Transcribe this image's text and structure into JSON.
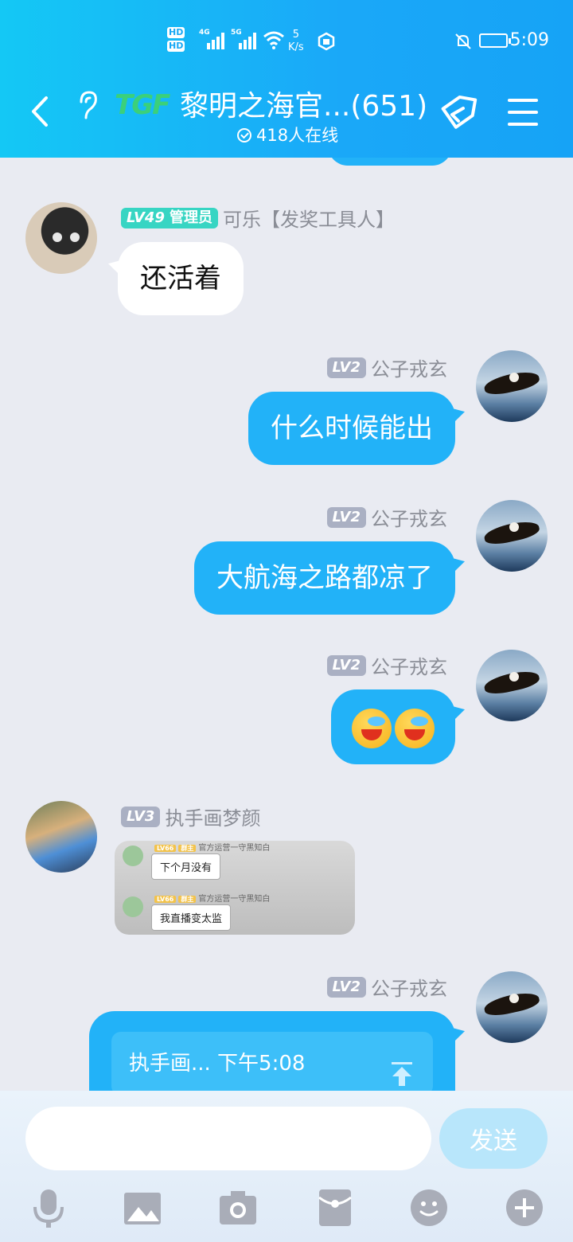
{
  "status_bar": {
    "hd1": "HD",
    "hd2": "HD",
    "net1": "4G",
    "net2": "5G",
    "speed_value": "5",
    "speed_unit": "K/s",
    "time": "5:09"
  },
  "header": {
    "group_logo": "TGF",
    "group_title": "黎明之海官...(651)",
    "online_count": "418人在线",
    "back_icon": "back-arrow-icon",
    "ear_icon": "ear-icon",
    "tag_icon": "tag-icon",
    "menu_icon": "menu-icon"
  },
  "messages": [
    {
      "side": "left",
      "level": "LV49",
      "role": "管理员",
      "sender": "可乐【发奖工具人】",
      "text": "还活着"
    },
    {
      "side": "right",
      "level": "LV2",
      "sender": "公子戎玄",
      "text": "什么时候能出"
    },
    {
      "side": "right",
      "level": "LV2",
      "sender": "公子戎玄",
      "text": "大航海之路都凉了"
    },
    {
      "side": "right",
      "level": "LV2",
      "sender": "公子戎玄",
      "text": "",
      "emojis": [
        "laugh-cry-emoji",
        "laugh-cry-emoji"
      ]
    },
    {
      "side": "left",
      "level": "LV3",
      "sender": "执手画梦颜",
      "image": {
        "rows": [
          {
            "badge_level": "LV66",
            "badge_role": "群主",
            "name": "官方运营一守黑知白",
            "text": "下个月没有"
          },
          {
            "badge_level": "LV66",
            "badge_role": "群主",
            "name": "官方运营一守黑知白",
            "text": "我直播变太监"
          }
        ]
      }
    },
    {
      "side": "right",
      "level": "LV2",
      "sender": "公子戎玄",
      "quote": "执手画... 下午5:08"
    }
  ],
  "input_bar": {
    "placeholder": "",
    "send_label": "发送",
    "tools": [
      "microphone-icon",
      "image-icon",
      "camera-icon",
      "red-packet-icon",
      "emoji-icon",
      "plus-icon"
    ]
  },
  "colors": {
    "header": "#16a9f7",
    "bubble_right": "#22b2f8",
    "bubble_left": "#ffffff",
    "background": "#e9ebf2",
    "admin_badge": "#37d5c3",
    "level_badge": "#aab0c3"
  }
}
